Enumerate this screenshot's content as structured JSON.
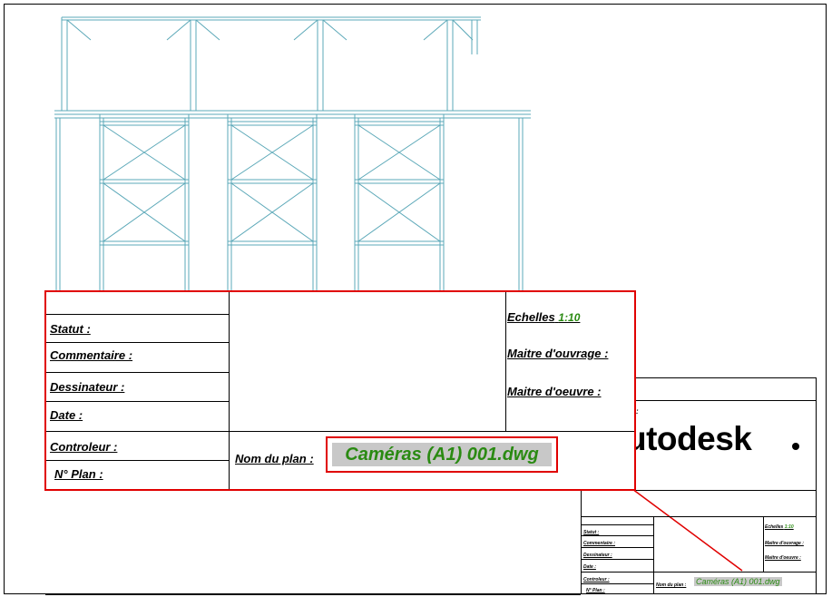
{
  "title_block": {
    "statut_label": "Statut :",
    "commentaire_label": "Commentaire :",
    "dessinateur_label": "Dessinateur :",
    "date_label": "Date :",
    "controleur_label": "Controleur :",
    "numero_plan_label": "N° Plan :",
    "nom_du_plan_label": "Nom du plan :",
    "file_name": "Caméras (A1) 001.dwg",
    "echelles_label": "Echelles",
    "scale_value": "1:10",
    "maitre_ouvrage_label": "Maitre d'ouvrage :",
    "maitre_oeuvre_label": "Maitre d'oeuvre :"
  },
  "brand": {
    "name": "autodesk",
    "partial_text": "utodesk"
  },
  "mini_block": {
    "scale_value": "1:10",
    "colon_mark": ":"
  },
  "colors": {
    "frame_line": "#5ba8b8",
    "highlight_red": "#e00000",
    "file_green": "#2a8a12",
    "field_grey": "#c8c8c8"
  }
}
